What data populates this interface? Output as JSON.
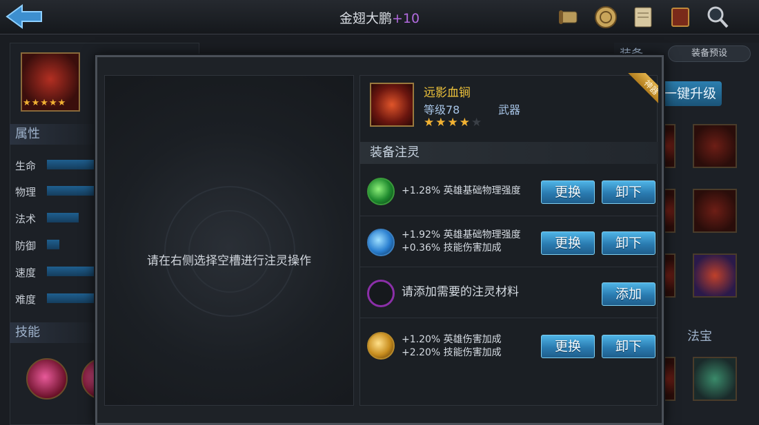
{
  "header": {
    "title": "金翅大鹏",
    "title_suffix": "+10",
    "icons": [
      "scroll-icon",
      "coin-icon",
      "map-icon",
      "book-icon",
      "magnifier-icon"
    ]
  },
  "left_panel": {
    "hero_stars": "★★★★★",
    "attributes_title": "属性",
    "stats": [
      {
        "label": "生命",
        "fill": 1.0
      },
      {
        "label": "物理",
        "fill": 1.0
      },
      {
        "label": "法术",
        "fill": 0.6
      },
      {
        "label": "防御",
        "fill": 0.25
      },
      {
        "label": "速度",
        "fill": 1.0
      },
      {
        "label": "难度",
        "fill": 1.0
      }
    ],
    "skills_title": "技能"
  },
  "right_panel": {
    "equip_title": "装备",
    "preset_label": "装备预设",
    "upgrade_label": "一键升级",
    "fabao_title": "法宝"
  },
  "modal": {
    "left_hint": "请在右侧选择空槽进行注灵操作",
    "item": {
      "name": "远影血锏",
      "level": "等级78",
      "type": "武器",
      "stars": "★★★★",
      "empty_stars": "★",
      "badge": "神器"
    },
    "section_title": "装备注灵",
    "slots": [
      {
        "gem": "green",
        "lines": [
          "+1.28% 英雄基础物理强度"
        ],
        "buttons": [
          "更换",
          "卸下"
        ]
      },
      {
        "gem": "blue",
        "lines": [
          "+1.92% 英雄基础物理强度",
          "+0.36% 技能伤害加成"
        ],
        "buttons": [
          "更换",
          "卸下"
        ]
      },
      {
        "gem": "empty",
        "lines": [
          "请添加需要的注灵材料"
        ],
        "buttons": [
          "添加"
        ]
      },
      {
        "gem": "gold",
        "lines": [
          "+1.20% 英雄伤害加成",
          "+2.20% 技能伤害加成"
        ],
        "buttons": [
          "更换",
          "卸下"
        ]
      }
    ]
  },
  "colors": {
    "accent_blue": "#2a7bb0",
    "gold_text": "#f0c43b",
    "suffix_purple": "#b36be0"
  }
}
